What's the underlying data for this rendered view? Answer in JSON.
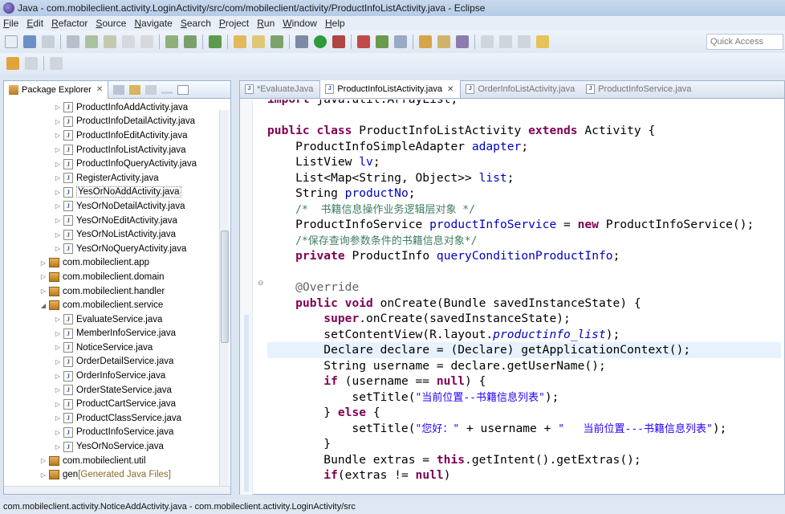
{
  "window": {
    "title": "Java - com.mobileclient.activity.LoginActivity/src/com/mobileclient/activity/ProductInfoListActivity.java - Eclipse"
  },
  "menu": [
    "File",
    "Edit",
    "Refactor",
    "Source",
    "Navigate",
    "Search",
    "Project",
    "Run",
    "Window",
    "Help"
  ],
  "quick_access": {
    "placeholder": "Quick Access"
  },
  "package_explorer": {
    "tab_label": "Package Explorer",
    "close": "✕",
    "items": [
      {
        "type": "file",
        "label": "ProductInfoAddActivity.java"
      },
      {
        "type": "file",
        "label": "ProductInfoDetailActivity.java"
      },
      {
        "type": "file",
        "label": "ProductInfoEditActivity.java"
      },
      {
        "type": "file",
        "label": "ProductInfoListActivity.java"
      },
      {
        "type": "file",
        "label": "ProductInfoQueryActivity.java"
      },
      {
        "type": "file",
        "label": "RegisterActivity.java"
      },
      {
        "type": "file",
        "label": "YesOrNoAddActivity.java",
        "selected": true
      },
      {
        "type": "file",
        "label": "YesOrNoDetailActivity.java"
      },
      {
        "type": "file",
        "label": "YesOrNoEditActivity.java"
      },
      {
        "type": "file",
        "label": "YesOrNoListActivity.java"
      },
      {
        "type": "file",
        "label": "YesOrNoQueryActivity.java"
      },
      {
        "type": "pkg",
        "label": "com.mobileclient.app",
        "expanded": false
      },
      {
        "type": "pkg",
        "label": "com.mobileclient.domain",
        "expanded": false
      },
      {
        "type": "pkg",
        "label": "com.mobileclient.handler",
        "expanded": false
      },
      {
        "type": "pkg",
        "label": "com.mobileclient.service",
        "expanded": true
      },
      {
        "type": "file",
        "label": "EvaluateService.java"
      },
      {
        "type": "file",
        "label": "MemberInfoService.java"
      },
      {
        "type": "file",
        "label": "NoticeService.java"
      },
      {
        "type": "file",
        "label": "OrderDetailService.java"
      },
      {
        "type": "file",
        "label": "OrderInfoService.java"
      },
      {
        "type": "file",
        "label": "OrderStateService.java"
      },
      {
        "type": "file",
        "label": "ProductCartService.java"
      },
      {
        "type": "file",
        "label": "ProductClassService.java"
      },
      {
        "type": "file",
        "label": "ProductInfoService.java"
      },
      {
        "type": "file",
        "label": "YesOrNoService.java"
      },
      {
        "type": "pkg",
        "label": "com.mobileclient.util",
        "expanded": false
      },
      {
        "type": "gen",
        "label": "gen",
        "suffix": "[Generated Java Files]"
      }
    ]
  },
  "editor": {
    "tabs": [
      {
        "label": "*EvaluateJava",
        "active": false
      },
      {
        "label": "ProductInfoListActivity.java",
        "active": true,
        "close": "✕"
      },
      {
        "label": "OrderInfoListActivity.java",
        "active": false
      },
      {
        "label": "ProductInfoService.java",
        "active": false
      }
    ],
    "lines": [
      {
        "html": "<span class=\"kw\">import</span> java.util.ArrayList;"
      },
      {
        "html": ""
      },
      {
        "html": "<span class=\"kw\">public class</span> ProductInfoListActivity <span class=\"kw\">extends</span> Activity {"
      },
      {
        "html": "    ProductInfoSimpleAdapter <span class=\"fld\">adapter</span>;"
      },
      {
        "html": "    ListView <span class=\"fld\">lv</span>;"
      },
      {
        "html": "    List&lt;Map&lt;String, Object&gt;&gt; <span class=\"fld\">list</span>;"
      },
      {
        "html": "    String <span class=\"fld\">productNo</span>;"
      },
      {
        "html": "    <span class=\"cm\">/*  书籍信息操作业务逻辑层对象 */</span>"
      },
      {
        "html": "    ProductInfoService <span class=\"fld\">productInfoService</span> = <span class=\"kw\">new</span> ProductInfoService();"
      },
      {
        "html": "    <span class=\"cm\">/*保存查询参数条件的书籍信息对象*/</span>"
      },
      {
        "html": "    <span class=\"kw\">private</span> ProductInfo <span class=\"fld\">queryConditionProductInfo</span>;"
      },
      {
        "html": ""
      },
      {
        "html": "    <span class=\"ann\">@Override</span>"
      },
      {
        "html": "    <span class=\"kw\">public void</span> onCreate(Bundle savedInstanceState) {"
      },
      {
        "html": "        <span class=\"kw\">super</span>.onCreate(savedInstanceState);"
      },
      {
        "html": "        setContentView(R.layout.<span class=\"it\">productinfo_list</span>);"
      },
      {
        "html": "        Declare declare = (Declare) getApplicationContext();",
        "highlight": true
      },
      {
        "html": "        String username = declare.getUserName();"
      },
      {
        "html": "        <span class=\"kw\">if</span> (username == <span class=\"kw\">null</span>) {"
      },
      {
        "html": "            setTitle(<span class=\"str\">\"当前位置--书籍信息列表\"</span>);"
      },
      {
        "html": "        } <span class=\"kw\">else</span> {"
      },
      {
        "html": "            setTitle(<span class=\"str\">\"您好：\"</span> + username + <span class=\"str\">\"   当前位置---书籍信息列表\"</span>);"
      },
      {
        "html": "        }"
      },
      {
        "html": "        Bundle extras = <span class=\"kw\">this</span>.getIntent().getExtras();"
      },
      {
        "html": "        <span class=\"kw\">if</span>(extras != <span class=\"kw\">null</span>)"
      }
    ]
  },
  "status": {
    "text": "com.mobileclient.activity.NoticeAddActivity.java - com.mobileclient.activity.LoginActivity/src"
  }
}
